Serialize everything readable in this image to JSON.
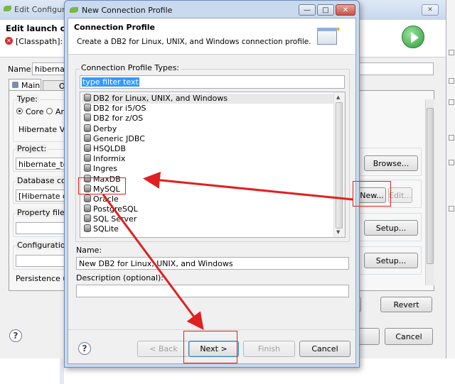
{
  "background_window": {
    "title": "Edit Configuratio",
    "heading": "Edit launch confi",
    "error_text": "[Classpath]: Cla",
    "name_label": "Name:",
    "name_value": "hibernate",
    "tab_main": "Main",
    "tab_other": "O",
    "type_label": "Type:",
    "type_core": "Core",
    "type_an": "An",
    "hibernate_version": "Hibernate Vers",
    "project_label": "Project:",
    "project_value": "hibernate_tool",
    "db_conn_label": "Database conn",
    "db_conn_value": "[Hibernate con",
    "property_file_label": "Property file:",
    "config_label": "Configuration f",
    "persistence_label": "Persistence uni",
    "browse_button": "Browse...",
    "new_button": "New...",
    "edit_button": "Edit...",
    "setup_button_1": "Setup...",
    "setup_button_2": "Setup...",
    "apply_fragment": "y",
    "revert_button": "Revert",
    "cancel_button": "Cancel",
    "close_glyph": "✕"
  },
  "dialog": {
    "title": "New Connection Profile",
    "header_title": "Connection Profile",
    "header_desc": "Create a DB2 for Linux, UNIX, and Windows connection profile.",
    "types_label": "Connection Profile Types:",
    "filter_value": "type filter text",
    "profile_types": [
      "DB2 for Linux, UNIX, and Windows",
      "DB2 for i5/OS",
      "DB2 for z/OS",
      "Derby",
      "Generic JDBC",
      "HSQLDB",
      "Informix",
      "Ingres",
      "MaxDB",
      "MySQL",
      "Oracle",
      "PostgreSQL",
      "SQL Server",
      "SQLite"
    ],
    "selected_index": 0,
    "name_label": "Name:",
    "name_value": "New DB2 for Linux, UNIX, and Windows",
    "description_label": "Description (optional):",
    "description_value": "",
    "back_button": "< Back",
    "next_button": "Next >",
    "finish_button": "Finish",
    "cancel_button": "Cancel",
    "minimize_glyph": "—",
    "maximize_glyph": "□",
    "close_glyph": "✕",
    "help_glyph": "?"
  },
  "colors": {
    "annotation_red": "#e02020",
    "selection_blue": "#3399ff",
    "dialog_frame": "#c9d9ee",
    "close_red": "#c75050",
    "green_run": "#3aa84a"
  }
}
